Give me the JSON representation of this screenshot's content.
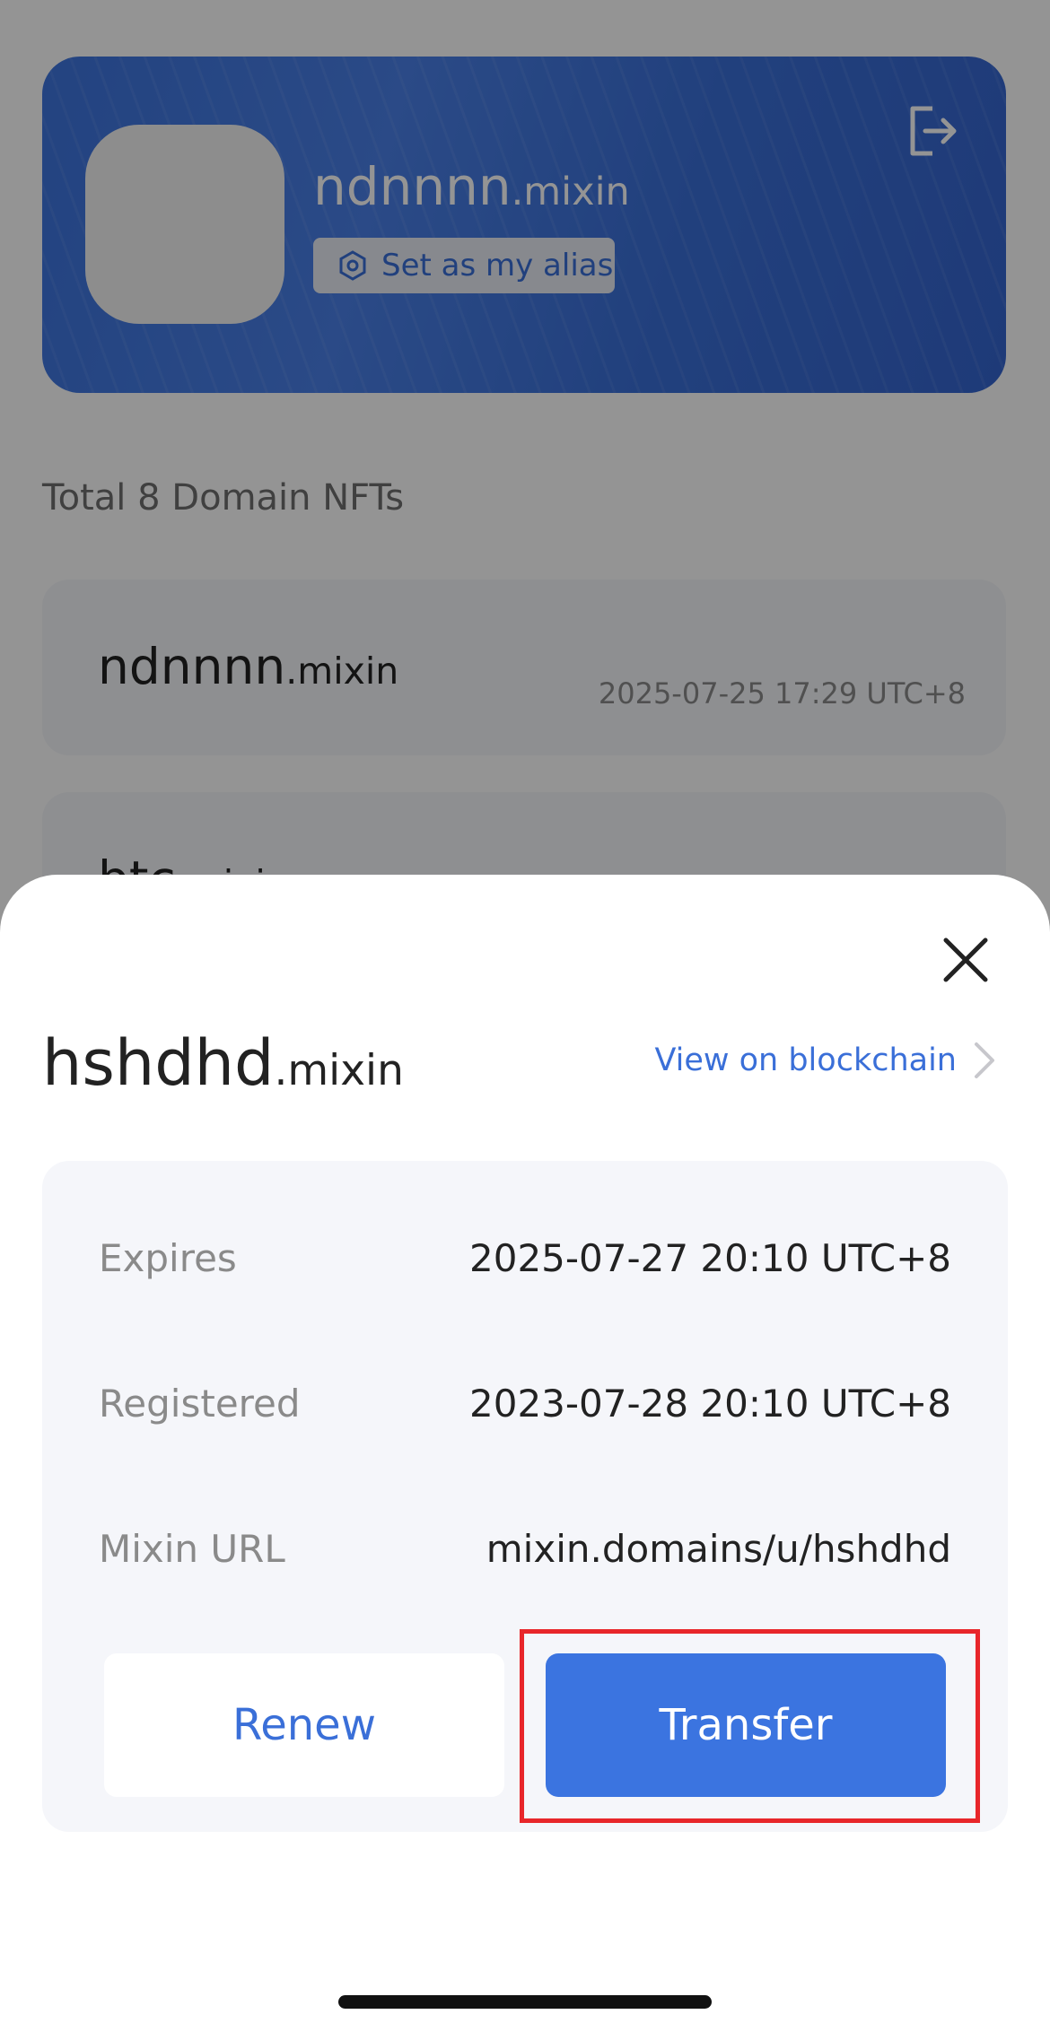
{
  "background": {
    "profile": {
      "name": "ndnnnn",
      "tld": ".mixin",
      "alias_button": "Set as my alias",
      "logout_icon": "logout-icon"
    },
    "total_label": "Total 8 Domain NFTs",
    "nft_list": [
      {
        "name": "ndnnnn",
        "tld": ".mixin",
        "date": "2025-07-25 17:29 UTC+8"
      },
      {
        "name": "btc",
        "tld": ".mixin",
        "date": ""
      }
    ]
  },
  "sheet": {
    "title_name": "hshdhd",
    "title_tld": ".mixin",
    "view_chain_label": "View on blockchain",
    "details": [
      {
        "label": "Expires",
        "value": "2025-07-27 20:10 UTC+8"
      },
      {
        "label": "Registered",
        "value": "2023-07-28 20:10 UTC+8"
      },
      {
        "label": "Mixin URL",
        "value": "mixin.domains/u/hshdhd"
      }
    ],
    "renew_label": "Renew",
    "transfer_label": "Transfer"
  },
  "colors": {
    "accent": "#3b74e0",
    "highlight": "#e8262a"
  }
}
